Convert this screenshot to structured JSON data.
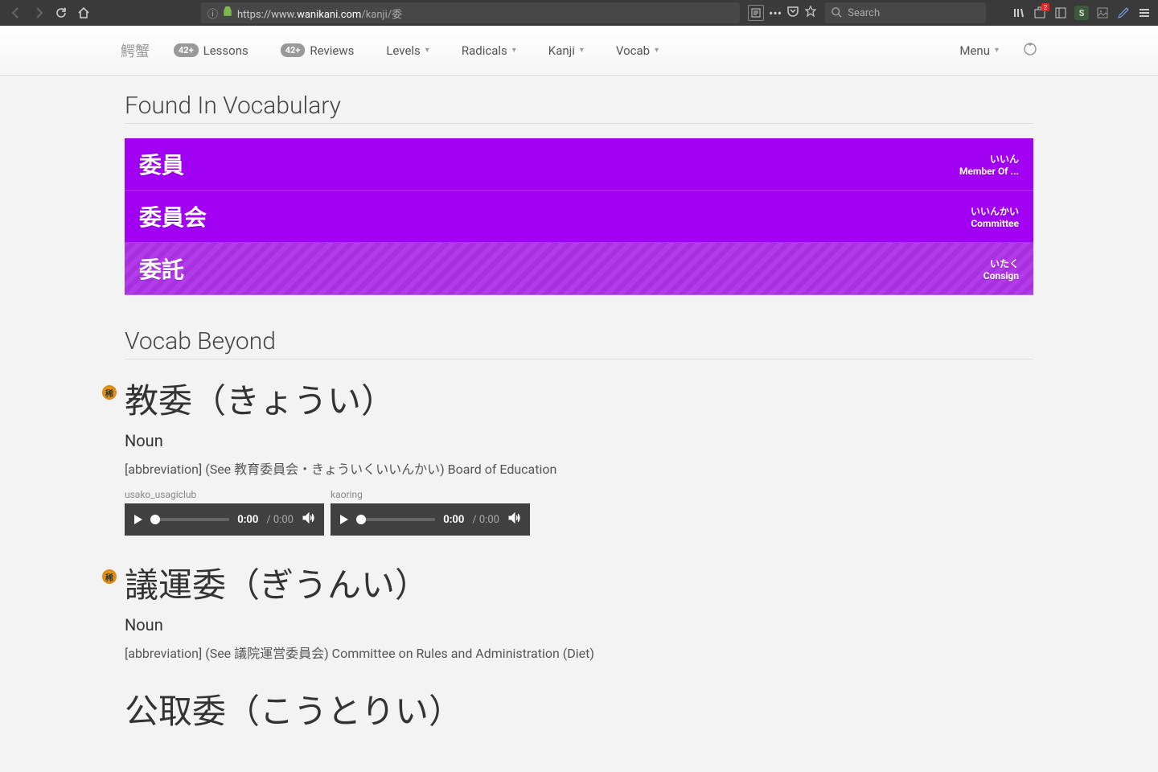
{
  "browser": {
    "url_protocol": "https://www.",
    "url_domain": "wanikani.com",
    "url_path": "/kanji/委",
    "search_placeholder": "Search",
    "badge_count": "2"
  },
  "nav": {
    "logo": "鰐蟹",
    "lessons_badge": "42+",
    "lessons_label": "Lessons",
    "reviews_badge": "42+",
    "reviews_label": "Reviews",
    "levels": "Levels",
    "radicals": "Radicals",
    "kanji": "Kanji",
    "vocab": "Vocab",
    "menu": "Menu"
  },
  "sections": {
    "found_in": "Found In Vocabulary",
    "beyond": "Vocab Beyond"
  },
  "vocab": [
    {
      "kanji": "委員",
      "reading": "いいん",
      "meaning": "Member Of ..."
    },
    {
      "kanji": "委員会",
      "reading": "いいんかい",
      "meaning": "Committee"
    },
    {
      "kanji": "委託",
      "reading": "いたく",
      "meaning": "Consign"
    }
  ],
  "beyond": [
    {
      "badge": "稀",
      "word": "教委（きょうい）",
      "pos": "Noun",
      "def": "[abbreviation] (See 教育委員会・きょういくいいんかい) Board of Education",
      "audio": [
        {
          "label": "usako_usagiclub",
          "current": "0:00",
          "total": "0:00"
        },
        {
          "label": "kaoring",
          "current": "0:00",
          "total": "0:00"
        }
      ]
    },
    {
      "badge": "稀",
      "word": "議運委（ぎうんい）",
      "pos": "Noun",
      "def": "[abbreviation] (See 議院運営委員会) Committee on Rules and Administration (Diet)",
      "audio": []
    },
    {
      "badge": "",
      "word": "公取委（こうとりい）",
      "pos": "",
      "def": "",
      "audio": []
    }
  ]
}
